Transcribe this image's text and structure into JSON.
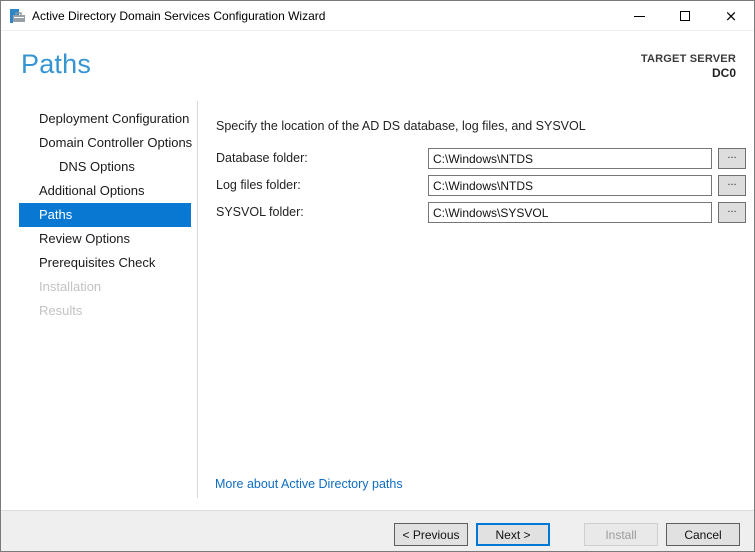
{
  "window": {
    "title": "Active Directory Domain Services Configuration Wizard",
    "icons": {
      "app": "server-manager-icon",
      "minimize": "minimize-icon",
      "maximize": "maximize-icon",
      "close": "close-icon"
    }
  },
  "header": {
    "page_title": "Paths",
    "target_server_label": "TARGET SERVER",
    "target_server_name": "DC0"
  },
  "sidebar": {
    "items": [
      {
        "label": "Deployment Configuration",
        "state": "enabled",
        "indent": 0
      },
      {
        "label": "Domain Controller Options",
        "state": "enabled",
        "indent": 0
      },
      {
        "label": "DNS Options",
        "state": "enabled",
        "indent": 1
      },
      {
        "label": "Additional Options",
        "state": "enabled",
        "indent": 0
      },
      {
        "label": "Paths",
        "state": "selected",
        "indent": 0
      },
      {
        "label": "Review Options",
        "state": "enabled",
        "indent": 0
      },
      {
        "label": "Prerequisites Check",
        "state": "enabled",
        "indent": 0
      },
      {
        "label": "Installation",
        "state": "disabled",
        "indent": 0
      },
      {
        "label": "Results",
        "state": "disabled",
        "indent": 0
      }
    ]
  },
  "main": {
    "instruction": "Specify the location of the AD DS database, log files, and SYSVOL",
    "fields": [
      {
        "label": "Database folder:",
        "value": "C:\\Windows\\NTDS",
        "browse_label": "..."
      },
      {
        "label": "Log files folder:",
        "value": "C:\\Windows\\NTDS",
        "browse_label": "..."
      },
      {
        "label": "SYSVOL folder:",
        "value": "C:\\Windows\\SYSVOL",
        "browse_label": "..."
      }
    ],
    "link_text": "More about Active Directory paths"
  },
  "footer": {
    "buttons": [
      {
        "label": "< Previous",
        "state": "enabled"
      },
      {
        "label": "Next >",
        "state": "default"
      },
      {
        "label": "Install",
        "state": "disabled"
      },
      {
        "label": "Cancel",
        "state": "enabled"
      }
    ]
  },
  "colors": {
    "selected_nav_bg": "#0878d3",
    "heading_blue": "#3595d3",
    "link_blue": "#0e6cc2",
    "default_button_border": "#0078d7",
    "footer_bg": "#efefef"
  }
}
